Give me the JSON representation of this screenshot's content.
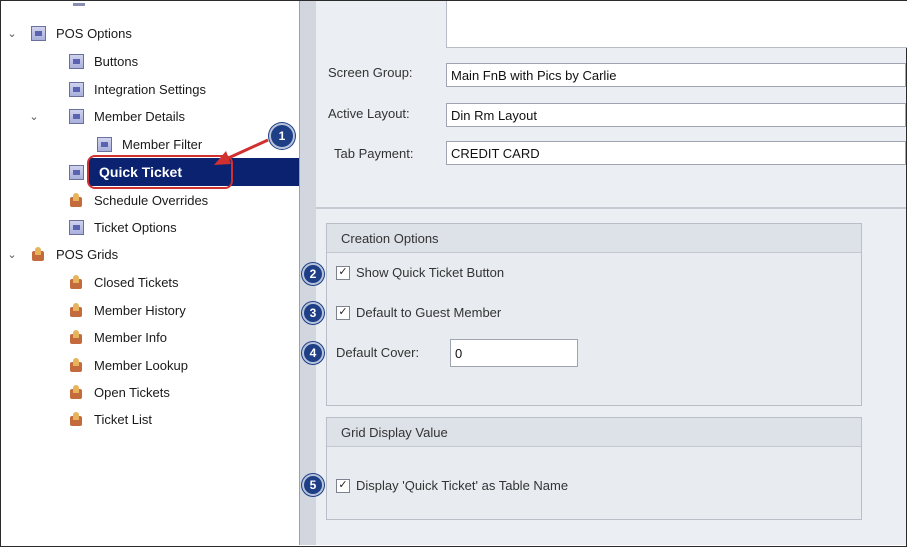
{
  "tree": {
    "items": [
      {
        "label": "POS Options",
        "icon": "form-icon",
        "expanded": true
      },
      {
        "label": "Buttons",
        "icon": "form-icon"
      },
      {
        "label": "Integration Settings",
        "icon": "form-icon"
      },
      {
        "label": "Member Details",
        "icon": "form-icon",
        "expanded": true
      },
      {
        "label": "Member Filter",
        "icon": "form-icon"
      },
      {
        "label": "Quick Ticket",
        "icon": "form-icon",
        "selected": true
      },
      {
        "label": "Schedule Overrides",
        "icon": "grid-icon"
      },
      {
        "label": "Ticket Options",
        "icon": "form-icon"
      },
      {
        "label": "POS Grids",
        "icon": "grid-icon",
        "expanded": true
      },
      {
        "label": "Closed Tickets",
        "icon": "grid-icon"
      },
      {
        "label": "Member History",
        "icon": "grid-icon"
      },
      {
        "label": "Member Info",
        "icon": "grid-icon"
      },
      {
        "label": "Member Lookup",
        "icon": "grid-icon"
      },
      {
        "label": "Open Tickets",
        "icon": "grid-icon"
      },
      {
        "label": "Ticket List",
        "icon": "grid-icon"
      }
    ]
  },
  "settings": {
    "screen_group_label": "Screen Group:",
    "screen_group_value": "Main FnB with Pics by Carlie",
    "active_layout_label": "Active Layout:",
    "active_layout_value": "Din Rm Layout",
    "tab_payment_label": "Tab Payment:",
    "tab_payment_value": "CREDIT CARD"
  },
  "creation_options": {
    "title": "Creation Options",
    "show_quick_ticket_label": "Show Quick Ticket Button",
    "show_quick_ticket_checked": true,
    "default_guest_label": "Default to Guest Member",
    "default_guest_checked": true,
    "default_cover_label": "Default Cover:",
    "default_cover_value": "0"
  },
  "grid_display": {
    "title": "Grid Display Value",
    "display_label": "Display 'Quick Ticket' as Table Name",
    "display_checked": true
  },
  "markers": [
    "1",
    "2",
    "3",
    "4",
    "5"
  ],
  "colors": {
    "selection": "#0b2270",
    "highlight": "#d03030",
    "marker": "#1e3f86",
    "panel": "#ebeef3"
  }
}
